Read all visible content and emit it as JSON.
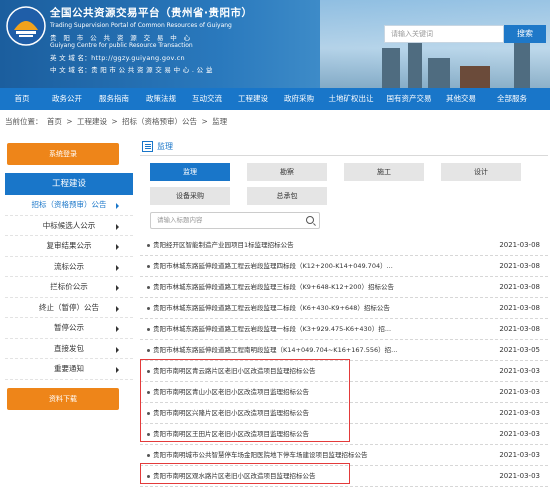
{
  "header": {
    "title_cn": "全国公共资源交易平台（贵州省·贵阳市）",
    "title_en": "Trading Supervision Portal of Common Resources of Guiyang",
    "center_cn": "贵 阳 市 公 共 资 源 交 易 中 心",
    "center_en": "Guiyang   Centre   for   public   Resource   Transaction",
    "en_domain": "英 文 域 名：http://ggzy.guiyang.gov.cn",
    "cn_domain": "中 文 域 名：贵 阳 市 公 共 资 源 交 易 中 心 . 公 益",
    "search_placeholder": "请输入关键词",
    "search_button": "搜索"
  },
  "nav": [
    "首页",
    "政务公开",
    "服务指南",
    "政策法规",
    "互动交流",
    "工程建设",
    "政府采购",
    "土地矿权出让",
    "国有资产交易",
    "其他交易",
    "全部服务"
  ],
  "breadcrumb": [
    "当前位置：",
    "首页",
    ">",
    "工程建设",
    ">",
    "招标（资格预审）公告",
    ">",
    "监理"
  ],
  "sidebar": {
    "top_button": "系统登录",
    "heading": "工程建设",
    "items": [
      "招标（资格预审）公告",
      "中标候选人公示",
      "复审结果公示",
      "流标公示",
      "拦标价公示",
      "终止（暂停）公告",
      "暂停公示",
      "直接发包",
      "重要通知"
    ],
    "bottom_button": "资料下载"
  },
  "main": {
    "section": "监理",
    "categories": [
      "监理",
      "勘察",
      "施工",
      "设计",
      "设备采购",
      "总承包"
    ],
    "filter_placeholder": "请输入标题内容",
    "rows": [
      {
        "title": "贵阳经开区智能制造产业园项目1标监理招标公告",
        "date": "2021-03-08"
      },
      {
        "title": "贵阳市林城东路延伸段道路工程云岩段监理四标段（K12+200-K14+049.704）...",
        "date": "2021-03-08"
      },
      {
        "title": "贵阳市林城东路延伸段道路工程云岩段监理三标段（K9+648-K12+200）招标公告",
        "date": "2021-03-08"
      },
      {
        "title": "贵阳市林城东路延伸段道路工程云岩段监理二标段（K6+430-K9+648）招标公告",
        "date": "2021-03-08"
      },
      {
        "title": "贵阳市林城东路延伸段道路工程云岩段监理一标段（K3+929.475-K6+430）招...",
        "date": "2021-03-08"
      },
      {
        "title": "贵阳市林城东路延伸段道路工程南明段监理（K14+049.704~K16+167.556）招...",
        "date": "2021-03-05"
      },
      {
        "title": "贵阳市南明区青云路片区老旧小区改造项目监理招标公告",
        "date": "2021-03-03"
      },
      {
        "title": "贵阳市南明区青山小区老旧小区改造项目监理招标公告",
        "date": "2021-03-03"
      },
      {
        "title": "贵阳市南明区兴隆片区老旧小区改造项目监理招标公告",
        "date": "2021-03-03"
      },
      {
        "title": "贵阳市南明区王田片区老旧小区改造项目监理招标公告",
        "date": "2021-03-03"
      },
      {
        "title": "贵阳市南明城市公共智慧停车场金阳医院地下停车场建设项目监理招标公告",
        "date": "2021-03-03"
      },
      {
        "title": "贵阳市南明区观水路片区老旧小区改造项目监理招标公告",
        "date": "2021-03-03"
      }
    ]
  },
  "colors": {
    "primary": "#1976c9",
    "orange": "#ee8519",
    "highlight": "#e33a3a"
  }
}
